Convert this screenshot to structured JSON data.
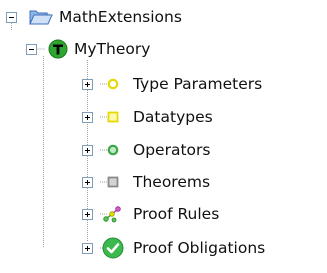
{
  "tree": {
    "root": {
      "label": "MathExtensions",
      "icon": "open-folder-icon",
      "expander": "collapse-minus-icon"
    },
    "theory": {
      "label": "MyTheory",
      "icon": "theory-t-icon",
      "expander": "collapse-minus-icon"
    },
    "children": [
      {
        "label": "Type Parameters",
        "icon": "yellow-circle-icon",
        "expander": "expand-plus-icon"
      },
      {
        "label": "Datatypes",
        "icon": "yellow-square-icon",
        "expander": "expand-plus-icon"
      },
      {
        "label": "Operators",
        "icon": "green-circle-icon",
        "expander": "expand-plus-icon"
      },
      {
        "label": "Theorems",
        "icon": "gray-square-icon",
        "expander": "expand-plus-icon"
      },
      {
        "label": "Proof Rules",
        "icon": "proof-rules-icon",
        "expander": "expand-plus-icon"
      },
      {
        "label": "Proof Obligations",
        "icon": "green-check-icon",
        "expander": "expand-plus-icon"
      }
    ]
  },
  "colors": {
    "text": "#111111",
    "tree_lines": "#a0a0a0",
    "expander_border": "#7f9db9",
    "theory_icon": "#2fa62f",
    "yellow_item": "#f2e400",
    "green_item": "#3aa64a",
    "gray_item": "#8a8a8a",
    "check_green": "#32b34a",
    "folder_blue": "#4a7fd4"
  }
}
